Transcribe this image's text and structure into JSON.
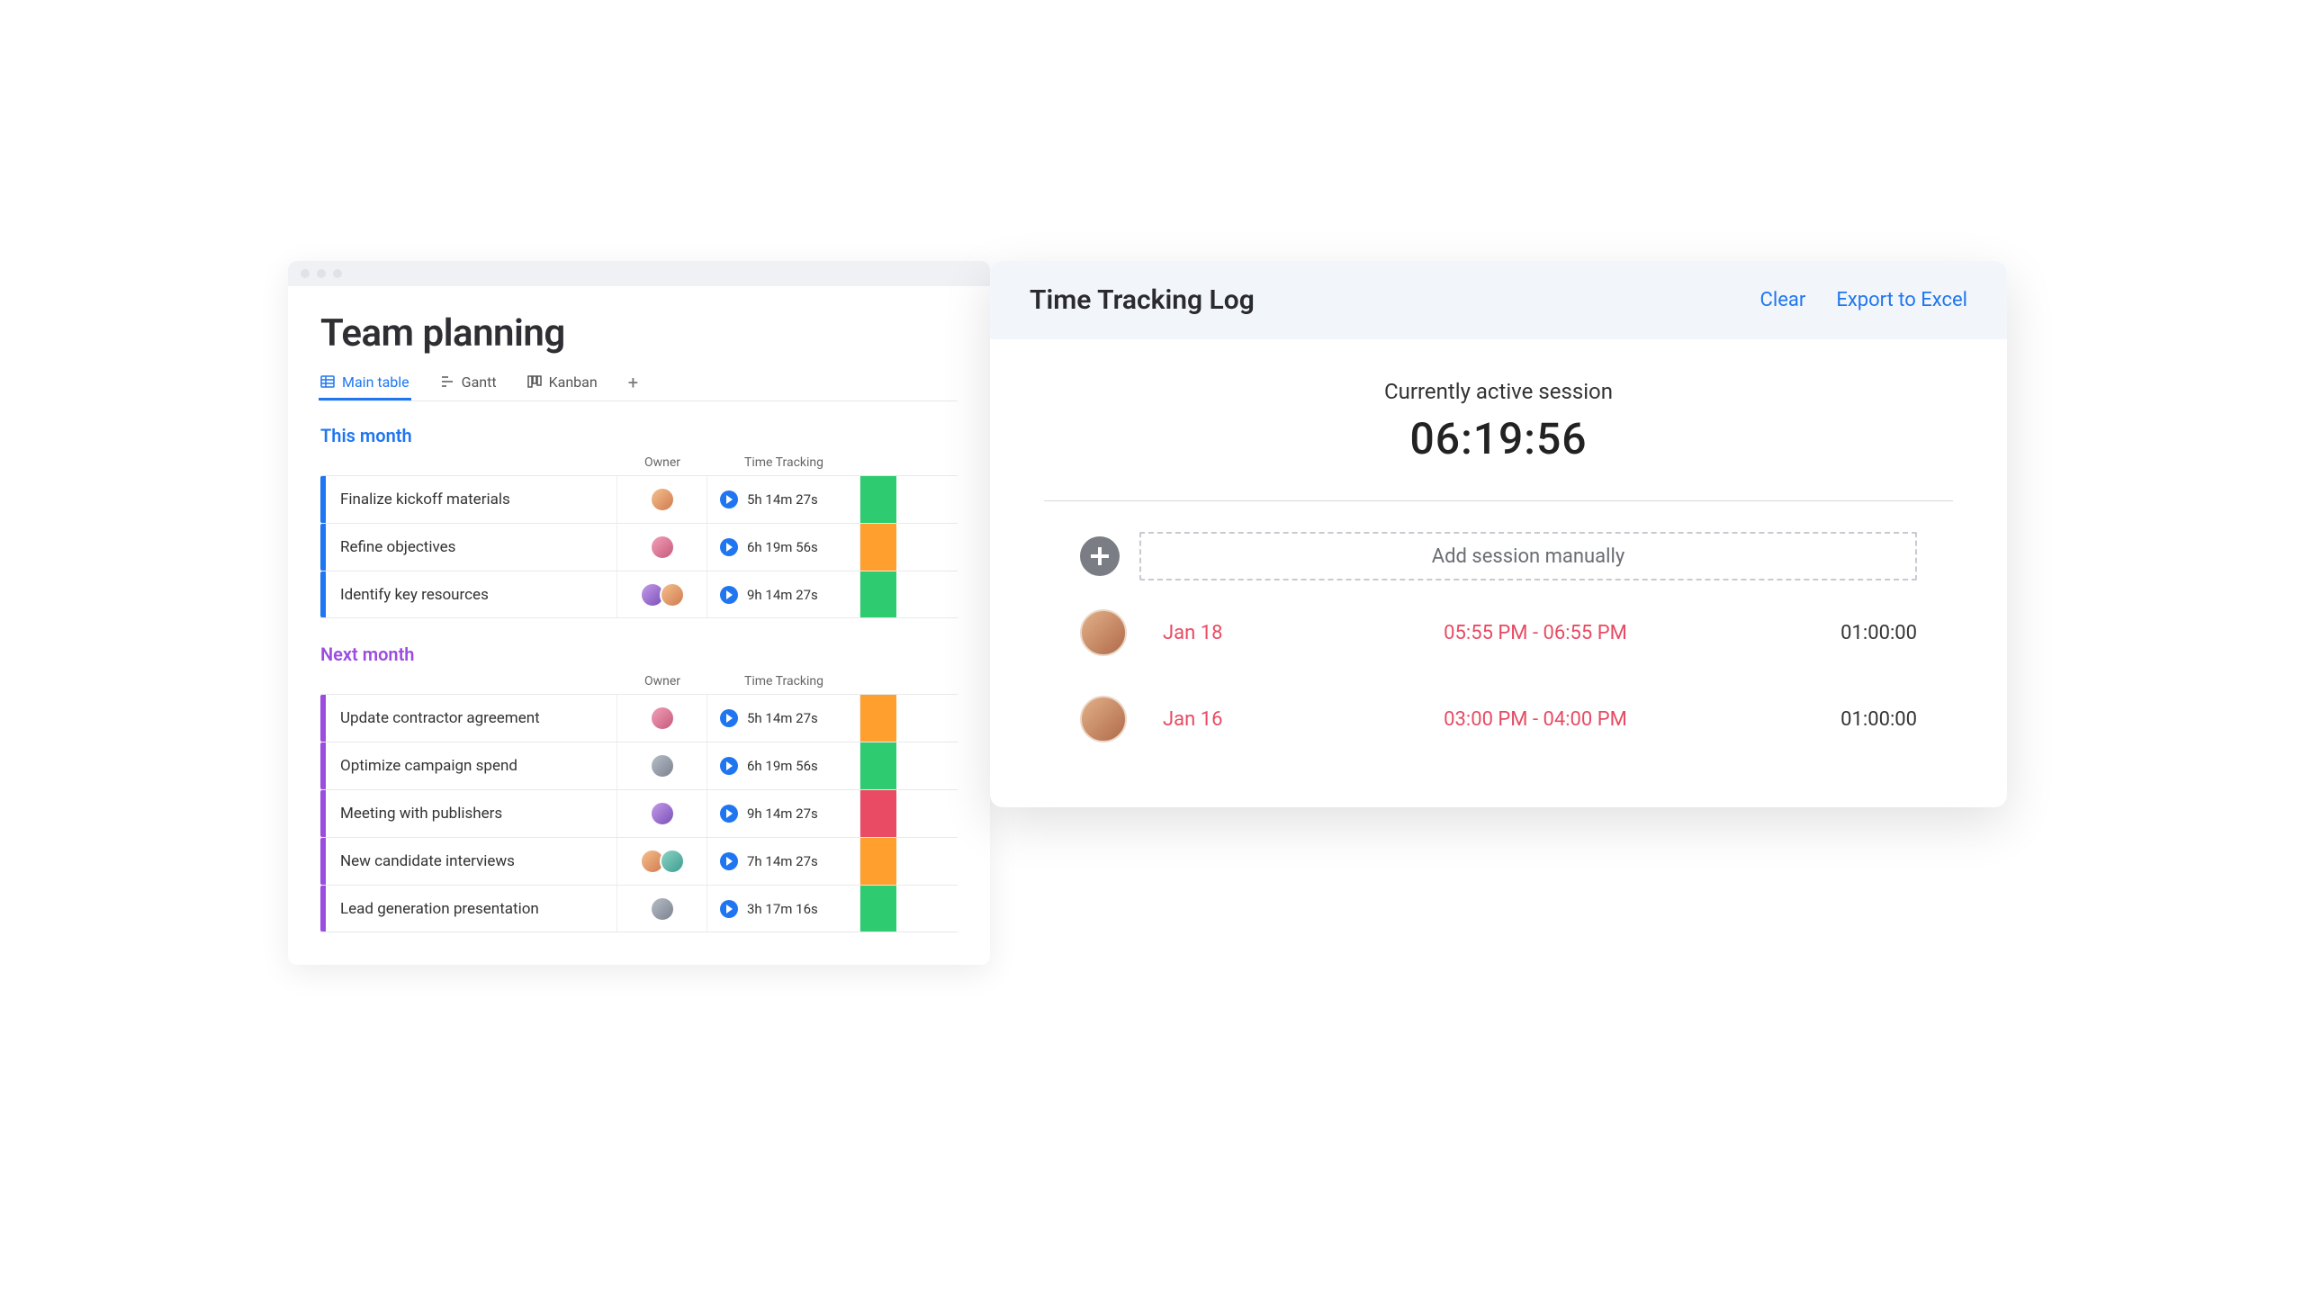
{
  "back": {
    "title": "Team planning",
    "tabs": {
      "main": "Main table",
      "gantt": "Gantt",
      "kanban": "Kanban"
    },
    "headers": {
      "owner": "Owner",
      "time_tracking": "Time Tracking"
    },
    "groups": [
      {
        "name": "This month",
        "color": "blue",
        "rows": [
          {
            "task": "Finalize kickoff materials",
            "avatars": [
              "a"
            ],
            "time": "5h 14m 27s",
            "status": "green"
          },
          {
            "task": "Refine objectives",
            "avatars": [
              "d"
            ],
            "time": "6h 19m 56s",
            "status": "orange"
          },
          {
            "task": "Identify key resources",
            "avatars": [
              "b",
              "a"
            ],
            "time": "9h 14m 27s",
            "status": "green"
          }
        ]
      },
      {
        "name": "Next month",
        "color": "purple",
        "rows": [
          {
            "task": "Update contractor agreement",
            "avatars": [
              "d"
            ],
            "time": "5h 14m 27s",
            "status": "orange"
          },
          {
            "task": "Optimize campaign spend",
            "avatars": [
              "e"
            ],
            "time": "6h 19m 56s",
            "status": "green"
          },
          {
            "task": "Meeting with publishers",
            "avatars": [
              "b"
            ],
            "time": "9h 14m 27s",
            "status": "red"
          },
          {
            "task": "New candidate interviews",
            "avatars": [
              "a",
              "c"
            ],
            "time": "7h 14m 27s",
            "status": "orange"
          },
          {
            "task": "Lead generation presentation",
            "avatars": [
              "e"
            ],
            "time": "3h 17m 16s",
            "status": "green"
          }
        ]
      }
    ]
  },
  "front": {
    "title": "Time Tracking Log",
    "clear": "Clear",
    "export": "Export to Excel",
    "active_label": "Currently active session",
    "active_time": "06:19:56",
    "add_manual": "Add session manually",
    "sessions": [
      {
        "date": "Jan 18",
        "range": "05:55 PM - 06:55 PM",
        "duration": "01:00:00"
      },
      {
        "date": "Jan 16",
        "range": "03:00 PM - 04:00 PM",
        "duration": "01:00:00"
      }
    ]
  }
}
